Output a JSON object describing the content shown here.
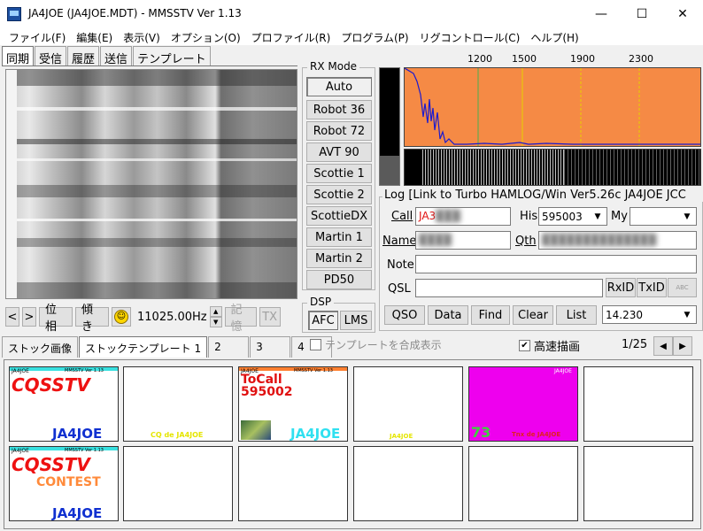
{
  "window": {
    "title": "JA4JOE (JA4JOE.MDT) - MMSSTV Ver 1.13",
    "minimize": "—",
    "maximize": "☐",
    "close": "✕"
  },
  "menu": [
    "ファイル(F)",
    "編集(E)",
    "表示(V)",
    "オプション(O)",
    "プロファイル(R)",
    "プログラム(P)",
    "リグコントロール(C)",
    "ヘルプ(H)"
  ],
  "main_tabs": [
    "同期",
    "受信",
    "履歴",
    "送信",
    "テンプレート"
  ],
  "image_controls": {
    "prev": "<",
    "next": ">",
    "sync_phase": "位相",
    "slant": "傾き",
    "frequency": "11025.00Hz",
    "memory": "記憶",
    "tx": "TX"
  },
  "rx_mode": {
    "title": "RX Mode",
    "modes": [
      "Auto",
      "Robot 36",
      "Robot 72",
      "AVT 90",
      "Scottie 1",
      "Scottie 2",
      "ScottieDX",
      "Martin 1",
      "Martin 2",
      "PD50"
    ]
  },
  "dsp": {
    "title": "DSP",
    "afc": "AFC",
    "lms": "LMS"
  },
  "spectrum": {
    "scale": [
      "1200",
      "1500",
      "1900",
      "2300"
    ],
    "background": "#f58a45",
    "level": 0.25
  },
  "log": {
    "title": "Log [Link to Turbo HAMLOG/Win Ver5.26c  JA4JOE JCC",
    "call_label": "Call",
    "call_value": "JA3",
    "his_label": "His",
    "his_value": "595003",
    "my_label": "My",
    "my_value": "",
    "name_label": "Name",
    "qth_label": "Qth",
    "note_label": "Note",
    "note_value": "",
    "qsl_label": "QSL",
    "qsl_value": "",
    "rxid": "RxID",
    "txid": "TxID",
    "buttons": [
      "QSO",
      "Data",
      "Find",
      "Clear",
      "List"
    ],
    "freq": "14.230"
  },
  "stock": {
    "tabs": [
      "ストック画像",
      "ストックテンプレート 1",
      "2",
      "3",
      "4"
    ],
    "composite_label": "テンプレートを合成表示",
    "fast_label": "高速描画",
    "fast_checked": "✔",
    "page": "1/25",
    "prev": "◀",
    "next": "▶"
  },
  "templates": [
    {
      "header": "JA4JOE",
      "sub": "MMSSTV Ver 1.13",
      "main": "CQSSTV",
      "mid": "",
      "bottom": "JA4JOE"
    },
    {
      "main": "",
      "bottom": "CQ de JA4JOE"
    },
    {
      "header": "JA4JOE",
      "sub": "MMSSTV Ver 1.13",
      "main": "ToCall",
      "mid": "595002",
      "bottom": "JA4JOE"
    },
    {
      "main": "",
      "bottom": "JA4JOE"
    },
    {
      "header": "JA4JOE",
      "main": "73",
      "bottom": "Tnx de JA4JOE"
    },
    {
      "main": ""
    },
    {
      "header": "JA4JOE",
      "sub": "MMSSTV Ver 1.13",
      "main": "CQSSTV",
      "mid": "CONTEST",
      "bottom": "JA4JOE"
    }
  ]
}
